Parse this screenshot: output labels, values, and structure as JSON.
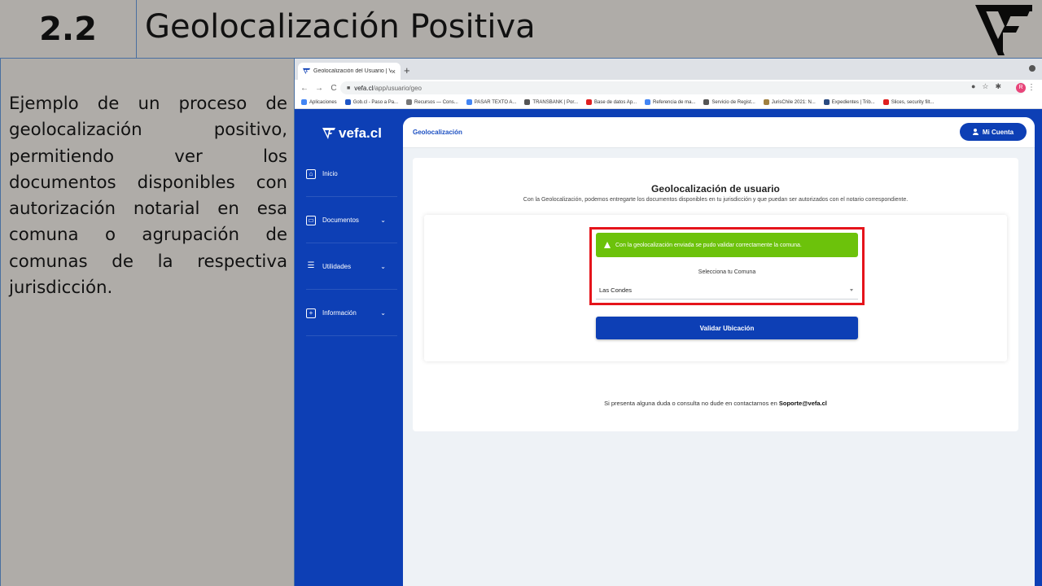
{
  "slide": {
    "number": "2.2",
    "title": "Geolocalización Positiva",
    "description": "Ejemplo de un proceso de geolocalización positivo, permitiendo ver los documentos disponibles con autorización notarial en esa comuna o agrupación de comunas de la respectiva jurisdicción."
  },
  "browser": {
    "tab_title": "Geolocalización del Usuario | V",
    "url_domain": "vefa.cl",
    "url_path": "/app/usuario/geo",
    "profile_initial": "R",
    "bookmarks": [
      {
        "label": "Aplicaciones",
        "color": "#4285f4"
      },
      {
        "label": "Gob.cl - Paso a Pa...",
        "color": "#1e56c6"
      },
      {
        "label": "Recursos — Cons...",
        "color": "#777777"
      },
      {
        "label": "PASAR TEXTO A...",
        "color": "#4285f4"
      },
      {
        "label": "TRANSBANK | Por...",
        "color": "#555555"
      },
      {
        "label": "Base de datos Ap...",
        "color": "#e02020"
      },
      {
        "label": "Referencia de ma...",
        "color": "#4285f4"
      },
      {
        "label": "Servicio de Regist...",
        "color": "#555555"
      },
      {
        "label": "JurisChile 2021: N...",
        "color": "#a08040"
      },
      {
        "label": "Expedientes | Trib...",
        "color": "#2a4a80"
      },
      {
        "label": "Slices, security filt...",
        "color": "#e02020"
      }
    ]
  },
  "app": {
    "brand": "vefa.cl",
    "nav": [
      {
        "label": "Inicio",
        "icon": "home-icon",
        "chevron": false
      },
      {
        "label": "Documentos",
        "icon": "archive-icon",
        "chevron": true
      },
      {
        "label": "Utilidades",
        "icon": "list-icon",
        "chevron": true
      },
      {
        "label": "Información",
        "icon": "plus-box-icon",
        "chevron": true
      }
    ],
    "breadcrumb": "Geolocalización",
    "account_button": "Mi Cuenta",
    "card_title": "Geolocalización de usuario",
    "card_subtitle": "Con la Geolocalización, podemos entregarte los documentos disponibles en tu jurisdicción y que puedan ser autorizados con el notario correspondiente.",
    "alert_text": "Con la geolocalización enviada se pudo validar correctamente la comuna.",
    "select_label": "Selecciona tu Comuna",
    "select_value": "Las Condes",
    "validate_button": "Validar Ubicación",
    "support_text": "Si presenta alguna duda o consulta no dude en contactarnos en",
    "support_email": "Soporte@vefa.cl"
  },
  "colors": {
    "slide_bg": "#afaca8",
    "app_blue": "#0d3fb5",
    "alert_green": "#6cc20b",
    "highlight_red": "#e5141b"
  }
}
